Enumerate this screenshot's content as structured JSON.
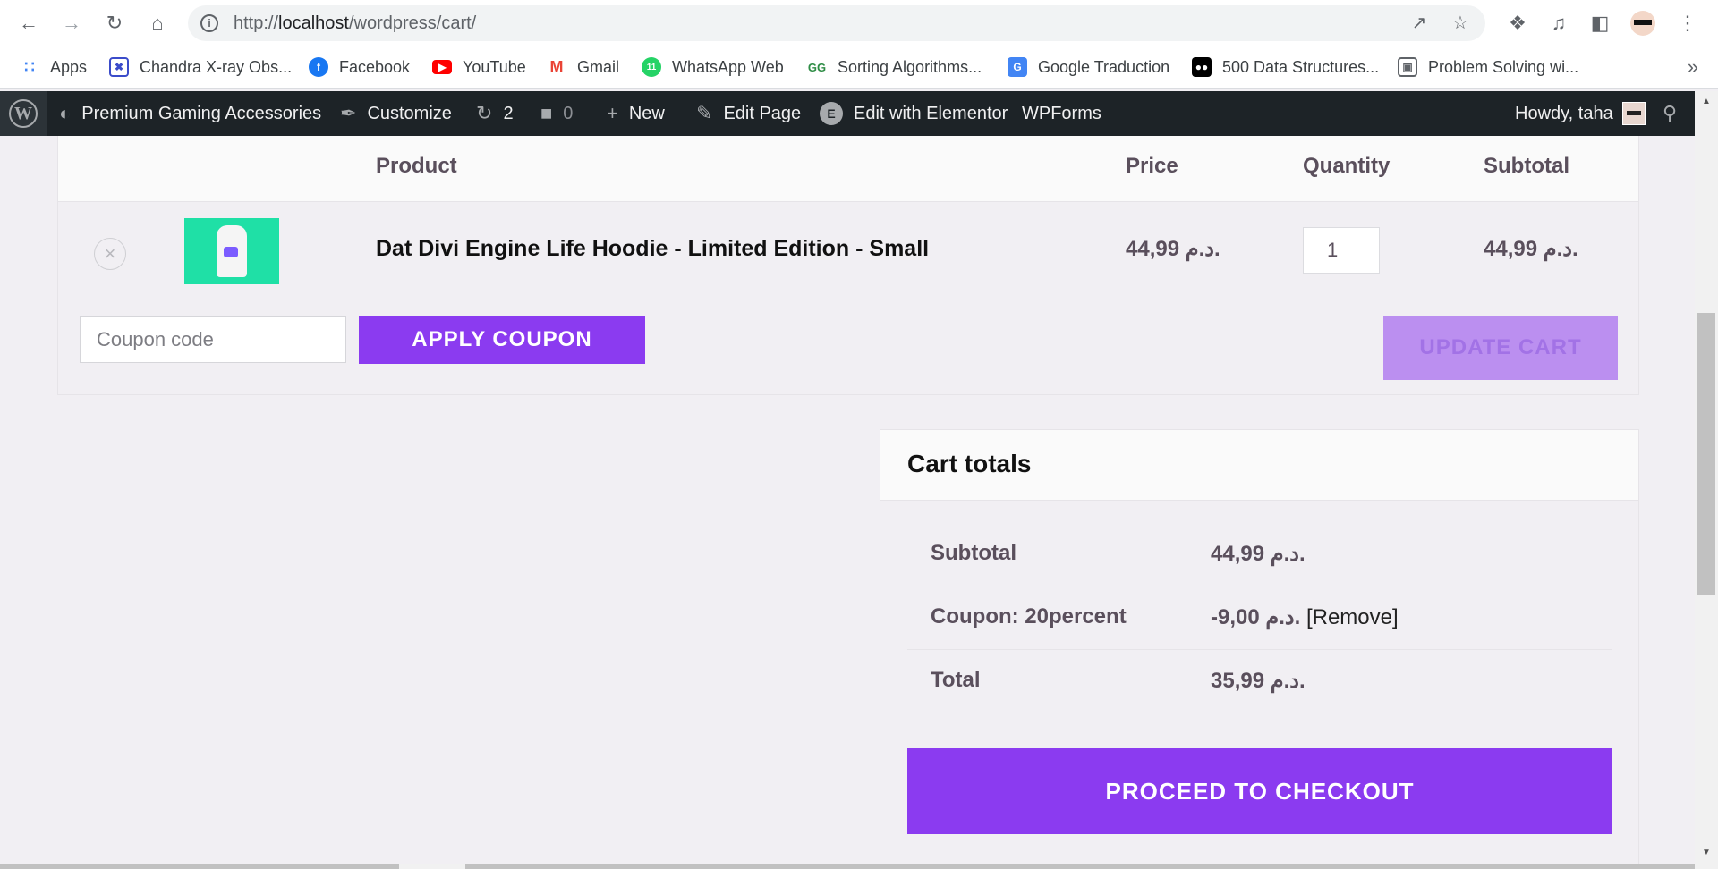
{
  "browser": {
    "url_scheme": "http://",
    "url_host": "localhost",
    "url_path": "/wordpress/cart/",
    "info_icon": "i"
  },
  "bookmarks": [
    {
      "label": "Apps",
      "icon": "apps-grid-icon"
    },
    {
      "label": "Chandra X-ray Obs...",
      "icon": "chandra-icon"
    },
    {
      "label": "Facebook",
      "icon": "facebook-icon"
    },
    {
      "label": "YouTube",
      "icon": "youtube-icon"
    },
    {
      "label": "Gmail",
      "icon": "gmail-icon"
    },
    {
      "label": "WhatsApp Web",
      "icon": "whatsapp-icon",
      "badge": "11"
    },
    {
      "label": "Sorting Algorithms...",
      "icon": "geeksforgeeks-icon"
    },
    {
      "label": "Google Traduction",
      "icon": "google-translate-icon"
    },
    {
      "label": "500 Data Structures...",
      "icon": "medium-icon"
    },
    {
      "label": "Problem Solving wi...",
      "icon": "doc-icon"
    }
  ],
  "adminbar": {
    "site_name": "Premium Gaming Accessories",
    "customize": "Customize",
    "updates_count": "2",
    "comments_count": "0",
    "new": "New",
    "edit_page": "Edit Page",
    "edit_elementor": "Edit with Elementor",
    "wpforms": "WPForms",
    "howdy": "Howdy, taha"
  },
  "cart": {
    "headers": {
      "product": "Product",
      "price": "Price",
      "quantity": "Quantity",
      "subtotal": "Subtotal"
    },
    "items": [
      {
        "name": "Dat Divi Engine Life Hoodie - Limited Edition - Small",
        "price": "44,99 د.م.",
        "quantity": "1",
        "subtotal": "44,99 د.م.",
        "remove": "×"
      }
    ],
    "coupon_placeholder": "Coupon code",
    "apply_coupon": "APPLY COUPON",
    "update_cart": "UPDATE CART"
  },
  "totals": {
    "title": "Cart totals",
    "subtotal_label": "Subtotal",
    "subtotal_value": "44,99 د.م.",
    "coupon_label": "Coupon: 20percent",
    "coupon_value": "-9,00 د.م.",
    "coupon_remove": "[Remove]",
    "total_label": "Total",
    "total_value": "35,99 د.م.",
    "checkout": "PROCEED TO CHECKOUT"
  },
  "colors": {
    "accent": "#8b3bf0",
    "accent_disabled": "#bb8ff0",
    "adminbar": "#1d2327",
    "page_bg": "#f1eff3"
  }
}
